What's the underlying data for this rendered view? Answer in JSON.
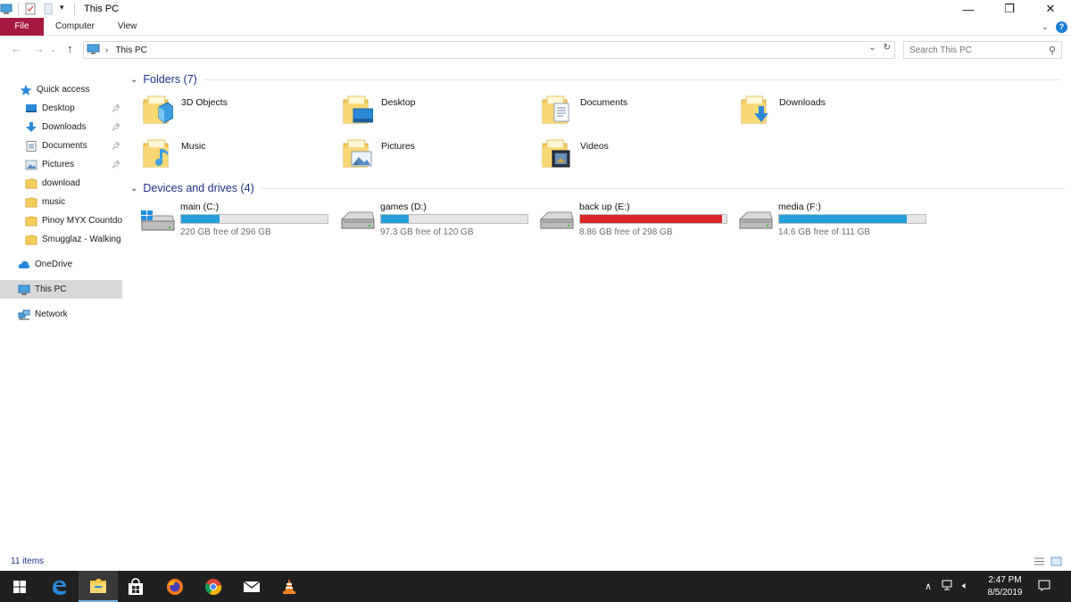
{
  "window": {
    "title": "This PC",
    "controls": {
      "minimize": "—",
      "maximize": "❐",
      "close": "✕"
    }
  },
  "ribbon": {
    "tabs": [
      {
        "label": "File"
      },
      {
        "label": "Computer"
      },
      {
        "label": "View"
      }
    ],
    "expand_icon": "chevron-down-icon",
    "help_label": "?"
  },
  "address": {
    "crumbs": [
      "This PC"
    ],
    "dropdown": "⌄",
    "refresh": "↻"
  },
  "search": {
    "placeholder": "Search This PC"
  },
  "sidebar": {
    "items": [
      {
        "label": "Quick access",
        "icon": "star-icon",
        "pinned": false
      },
      {
        "label": "Desktop",
        "icon": "desktop-icon",
        "pinned": true
      },
      {
        "label": "Downloads",
        "icon": "download-arrow-icon",
        "pinned": true
      },
      {
        "label": "Documents",
        "icon": "documents-icon",
        "pinned": true
      },
      {
        "label": "Pictures",
        "icon": "pictures-icon",
        "pinned": true
      },
      {
        "label": "download",
        "icon": "folder-icon",
        "pinned": false
      },
      {
        "label": "music",
        "icon": "folder-icon",
        "pinned": false
      },
      {
        "label": "Pinoy MYX Countdown",
        "icon": "folder-icon",
        "pinned": false
      },
      {
        "label": "Smugglaz - Walking",
        "icon": "folder-icon",
        "pinned": false
      },
      {
        "label": "OneDrive",
        "icon": "cloud-icon",
        "pinned": false
      },
      {
        "label": "This PC",
        "icon": "computer-icon",
        "pinned": false,
        "selected": true
      },
      {
        "label": "Network",
        "icon": "network-icon",
        "pinned": false
      }
    ]
  },
  "folders": {
    "header": "Folders (7)",
    "items": [
      {
        "label": "3D Objects",
        "icon": "3d-objects-folder-icon"
      },
      {
        "label": "Desktop",
        "icon": "desktop-folder-icon"
      },
      {
        "label": "Documents",
        "icon": "documents-folder-icon"
      },
      {
        "label": "Downloads",
        "icon": "downloads-folder-icon"
      },
      {
        "label": "Music",
        "icon": "music-folder-icon"
      },
      {
        "label": "Pictures",
        "icon": "pictures-folder-icon"
      },
      {
        "label": "Videos",
        "icon": "videos-folder-icon"
      }
    ]
  },
  "drives": {
    "header": "Devices and drives (4)",
    "items": [
      {
        "label": "main (C:)",
        "free_text": "220 GB free of 296 GB",
        "used_fraction": 0.26,
        "status": "normal",
        "windows": true
      },
      {
        "label": "games (D:)",
        "free_text": "97.3 GB free of 120 GB",
        "used_fraction": 0.19,
        "status": "normal",
        "windows": false
      },
      {
        "label": "back up (E:)",
        "free_text": "8.86 GB free of 298 GB",
        "used_fraction": 0.97,
        "status": "full",
        "windows": false
      },
      {
        "label": "media (F:)",
        "free_text": "14.6 GB free of 111 GB",
        "used_fraction": 0.87,
        "status": "normal",
        "windows": false
      }
    ]
  },
  "status": {
    "count": "11 items"
  },
  "taskbar": {
    "apps": [
      {
        "name": "start-button",
        "icon": "windows-logo-icon"
      },
      {
        "name": "edge-app",
        "icon": "edge-icon"
      },
      {
        "name": "file-explorer-app",
        "icon": "file-explorer-icon",
        "active": true
      },
      {
        "name": "store-app",
        "icon": "store-icon"
      },
      {
        "name": "firefox-app",
        "icon": "firefox-icon"
      },
      {
        "name": "chrome-app",
        "icon": "chrome-icon"
      },
      {
        "name": "mail-app",
        "icon": "mail-icon"
      },
      {
        "name": "vlc-app",
        "icon": "vlc-icon"
      }
    ],
    "time": "2:47 PM",
    "date": "8/5/2019"
  },
  "colors": {
    "accent": "#1e3287",
    "file_tab": "#a6193e",
    "drive_bar": "#26a0da",
    "drive_bar_full": "#da2626",
    "taskbar": "#202020"
  }
}
